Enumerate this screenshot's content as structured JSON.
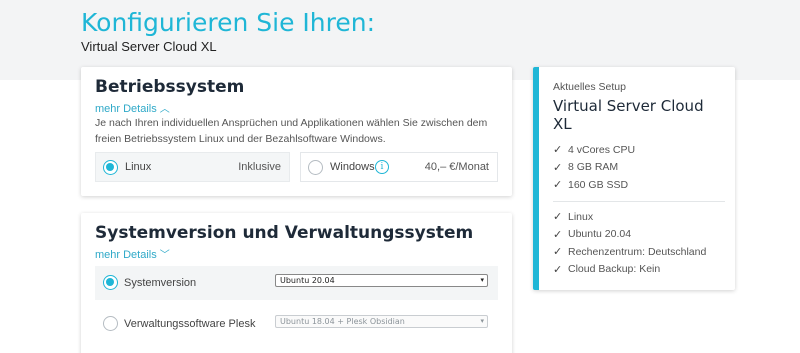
{
  "header": {
    "title": "Konfigurieren Sie Ihren:",
    "subtitle": "Virtual Server Cloud XL"
  },
  "betriebssystem": {
    "title": "Betriebssystem",
    "more_details": "mehr Details",
    "description": "Je nach Ihren individuellen Ansprüchen und Applikationen wählen Sie zwischen dem freien Betriebssystem Linux und der Bezahlsoftware Windows.",
    "options": [
      {
        "label": "Linux",
        "price": "Inklusive",
        "selected": true
      },
      {
        "label": "Windows",
        "price": "40,– €/Monat",
        "selected": false,
        "icon": "info-icon"
      }
    ]
  },
  "systemversion": {
    "title": "Systemversion und Verwaltungssystem",
    "more_details": "mehr Details",
    "rows": [
      {
        "label": "Systemversion",
        "select_value": "Ubuntu 20.04",
        "selected": true,
        "disabled": false
      },
      {
        "label": "Verwaltungssoftware Plesk",
        "select_value": "Ubuntu 18.04 + Plesk Obsidian",
        "selected": false,
        "disabled": true
      }
    ]
  },
  "setup": {
    "caption": "Aktuelles Setup",
    "title": "Virtual Server Cloud XL",
    "specs": [
      "4 vCores CPU",
      "8 GB RAM",
      "160 GB SSD"
    ],
    "config": [
      "Linux",
      "Ubuntu 20.04",
      "Rechenzentrum: Deutschland",
      "Cloud Backup: Kein"
    ]
  },
  "colors": {
    "accent": "#1fb6d6",
    "heading": "#1e2a38",
    "band": "#f3f4f5"
  }
}
